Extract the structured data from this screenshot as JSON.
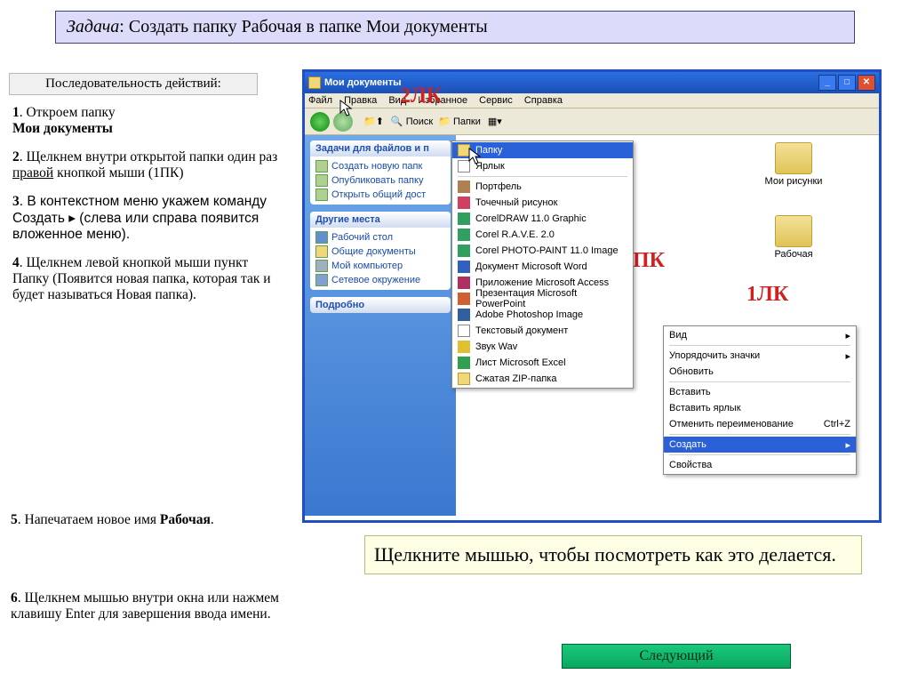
{
  "task": {
    "prefix_italic": "Задача",
    "text": ": Создать папку Рабочая в папке Мои документы"
  },
  "sequence_label": "Последовательность действий:",
  "steps": {
    "s1_a": "1",
    "s1_b": ". Откроем папку ",
    "s1_c": "Мои документы",
    "s2_a": "2",
    "s2_b": ". Щелкнем внутри открытой папки один раз ",
    "s2_c": "правой",
    "s2_d": " кнопкой мыши (1ПК)",
    "s3_a": "3",
    "s3_b": ". В контекстном меню укажем  команду Создать ▸  (слева или справа появится вложенное меню).",
    "s4_a": "4",
    "s4_b": ". Щелкнем левой кнопкой мыши пункт Папку (Появится новая папка, которая так и будет называться Новая папка).",
    "s5_a": "5",
    "s5_b": ". Напечатаем новое имя ",
    "s5_c": "Рабочая",
    "s5_d": ".",
    "s6_a": "6",
    "s6_b": ". Щелкнем мышью внутри окна или нажмем клавишу Enter для завершения ввода имени."
  },
  "xp": {
    "title": "Мои документы",
    "menu": {
      "file": "Файл",
      "edit": "Правка",
      "view": "Вид",
      "fav": "Избранное",
      "service": "Сервис",
      "help": "Справка"
    },
    "toolbar": {
      "search": "Поиск",
      "folders": "Папки"
    },
    "side": {
      "tasks_head": "Задачи для файлов и п",
      "tasks": {
        "t1": "Создать новую папк",
        "t2": "Опубликовать папку",
        "t3": "Открыть общий дост"
      },
      "places_head": "Другие места",
      "places": {
        "p1": "Рабочий стол",
        "p2": "Общие документы",
        "p3": "Мой компьютер",
        "p4": "Сетевое окружение"
      },
      "details_head": "Подробно"
    },
    "content_items": {
      "i1": "Мои рисунки",
      "i2": "Рабочая"
    }
  },
  "submenu": {
    "i0": "Папку",
    "i1": "Ярлык",
    "i2": "Портфель",
    "i3": "Точечный рисунок",
    "i4": "CorelDRAW 11.0 Graphic",
    "i5": "Corel R.A.V.E. 2.0",
    "i6": "Corel PHOTO-PAINT 11.0 Image",
    "i7": "Документ Microsoft Word",
    "i8": "Приложение Microsoft Access",
    "i9": "Презентация Microsoft PowerPoint",
    "i10": "Adobe Photoshop Image",
    "i11": "Текстовый документ",
    "i12": "Звук Wav",
    "i13": "Лист Microsoft Excel",
    "i14": "Сжатая ZIP-папка"
  },
  "ctxmenu": {
    "view": "Вид",
    "arrange": "Упорядочить значки",
    "refresh": "Обновить",
    "paste": "Вставить",
    "paste_lnk": "Вставить ярлык",
    "undo": "Отменить переименование",
    "undo_key": "Ctrl+Z",
    "create": "Создать",
    "props": "Свойства"
  },
  "annotations": {
    "a2lk": "2ЛК",
    "a1pk": "1ПК",
    "a1lk": "1ЛК"
  },
  "hint": "Щелкните мышью, чтобы посмотреть как это делается.",
  "next": "Следующий"
}
